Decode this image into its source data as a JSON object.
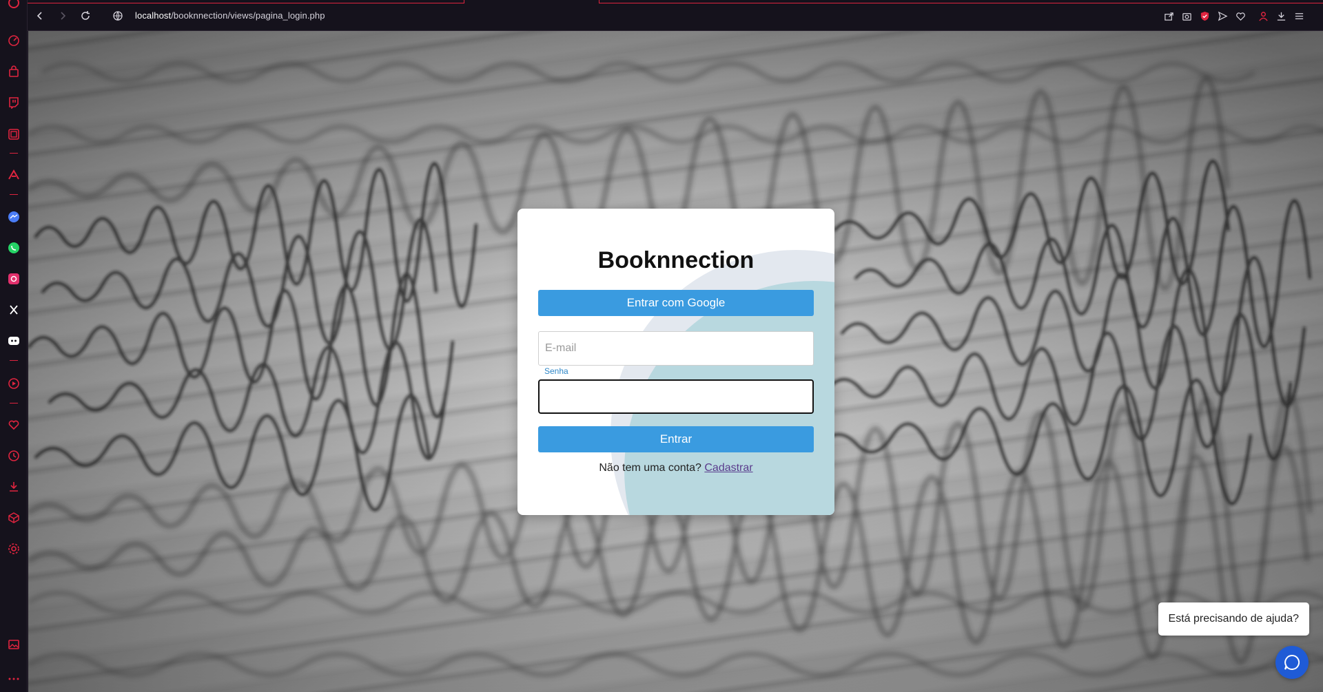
{
  "browser": {
    "url_host": "localhost",
    "url_path": "/booknnection/views/pagina_login.php",
    "accent_color": "#e0243f"
  },
  "sidebar": {
    "items": [
      {
        "icon": "speed-dial-icon"
      },
      {
        "icon": "shopping-bag-icon"
      },
      {
        "icon": "twitch-icon"
      },
      {
        "icon": "tabs-icon"
      },
      {
        "icon": "aria-icon"
      },
      {
        "icon": "messenger-icon"
      },
      {
        "icon": "whatsapp-icon"
      },
      {
        "icon": "instagram-icon"
      },
      {
        "icon": "x-icon"
      },
      {
        "icon": "discord-icon"
      },
      {
        "icon": "player-icon"
      },
      {
        "icon": "heart-icon"
      },
      {
        "icon": "history-icon"
      },
      {
        "icon": "downloads-icon"
      },
      {
        "icon": "extensions-icon"
      },
      {
        "icon": "settings-icon"
      },
      {
        "icon": "wallpaper-icon"
      },
      {
        "icon": "more-icon"
      }
    ]
  },
  "login": {
    "brand": "Booknnection",
    "google_button": "Entrar com Google",
    "email_placeholder": "E-mail",
    "password_label": "Senha",
    "password_value": "",
    "submit_button": "Entrar",
    "signup_prompt": "Não tem uma conta?",
    "signup_link": "Cadastrar",
    "button_color": "#3a9be0"
  },
  "help": {
    "bubble_text": "Está precisando de ajuda?",
    "chat_button_color": "#1f5bd6"
  }
}
